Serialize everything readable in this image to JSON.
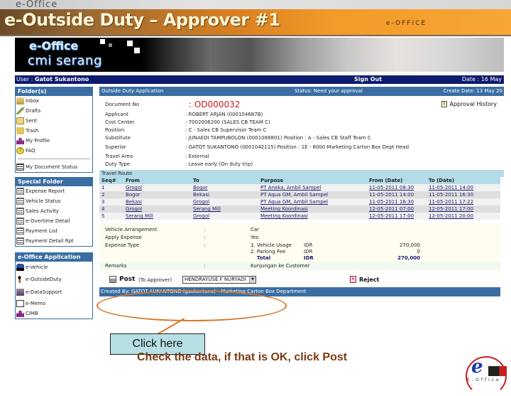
{
  "slide": {
    "top_logo": "e-Office",
    "title": "e-Outside Duty – Approver #1",
    "top_brand_right": "e-OFFICE"
  },
  "hero": {
    "line1": "e-Office",
    "line2": "cmi serang"
  },
  "userbar": {
    "user_label": "User : ",
    "user_name": "Gatot Sukantono",
    "sign_out": "Sign Out",
    "date": "Date : 16 May"
  },
  "sidebar": {
    "folders": {
      "title": "Folder(s)",
      "items": [
        {
          "label": "Inbox",
          "icon": "inbox-folder-icon"
        },
        {
          "label": "Drafts",
          "icon": "drafts-pen-icon"
        },
        {
          "label": "Sent",
          "icon": "sent-mail-icon"
        },
        {
          "label": "Trash",
          "icon": "trash-icon"
        },
        {
          "label": "My Profile",
          "icon": "user-icon"
        },
        {
          "label": "FAQ",
          "icon": "faq-icon"
        }
      ],
      "status_item": {
        "label": "My Document Status",
        "icon": "document-status-icon"
      }
    },
    "special": {
      "title": "Special Folder",
      "items": [
        {
          "label": "Expense Report"
        },
        {
          "label": "Vehicle Status"
        },
        {
          "label": "Sales Activity"
        },
        {
          "label": "e-Overtime Detail"
        },
        {
          "label": "Payment List"
        },
        {
          "label": "Payment Detail Rpt"
        }
      ]
    },
    "apps": {
      "title": "e-Office Application",
      "items": [
        {
          "label": "e-Vehicle",
          "icon": "car-icon"
        },
        {
          "label": "e-OutsideDuty",
          "icon": "walker-icon"
        },
        {
          "label": "e-DataSupport",
          "icon": "data-support-icon"
        },
        {
          "label": "e-Memo",
          "icon": "memo-icon"
        },
        {
          "label": "CIMB",
          "icon": "user-icon"
        }
      ]
    }
  },
  "main": {
    "header": {
      "title": "Outside Duty Application",
      "status": "Status: Need your approval",
      "create_date": "Create Date: 13 May 20"
    },
    "document_no_label": "Document No",
    "document_no": ": OD000032",
    "approval_history": "Approval History",
    "fields": [
      {
        "label": "Applicant",
        "value": ": ROBERT ARJAN (000104687B)"
      },
      {
        "label": "Cost Center",
        "value": ": 7002006200 (SALES CB TEAM C)"
      },
      {
        "label": "Position",
        "value": ": C - Sales CB Supervisor Team C"
      },
      {
        "label": "Substitute",
        "value": ": JUNAEDI TAMPUBOLON (0001088801) Position : A - Sales CB Staff Team C"
      },
      {
        "label": "Superior",
        "value": ": GATOT SUKANTONO (0001042115) Position : 1E - 8000 Marketing Carton Box Dept Head"
      },
      {
        "label": "Travel Area",
        "value": ": External"
      },
      {
        "label": "Duty Type",
        "value": ": Leave early (On duty trip)"
      }
    ],
    "route": {
      "title": "Travel Route",
      "columns": [
        "Seq#",
        "From",
        "To",
        "Purpose",
        "From (Date)",
        "To (Date)"
      ],
      "rows": [
        [
          "1",
          "Grogol",
          "Bogor",
          "PT Aneka, Ambil Sampel",
          "11-05-2011 08:30",
          "11-05-2011 14:00"
        ],
        [
          "2",
          "Bogor",
          "Bekasi",
          "PT Aqua GM, Ambil Sampel",
          "11-05-2011 14:00",
          "11-05-2011 16:30"
        ],
        [
          "3",
          "Bekasi",
          "Grogol",
          "PT Aqua GM, Ambil Sampel",
          "11-05-2011 16:30",
          "11-05-2011 17:22"
        ],
        [
          "4",
          "Grogol",
          "Serang Mill",
          "Meeting Koordinasi",
          "12-05-2011 07:00",
          "12-05-2011 17:00"
        ],
        [
          "5",
          "Serang Mill",
          "Grogol",
          "Meeting Koordinasi",
          "12-05-2011 17:00",
          "12-05-2011 20:00"
        ]
      ]
    },
    "vehicle_arrangement_label": "Vehicle Arrangement",
    "vehicle_arrangement_value": "Car",
    "apply_expense_label": "Apply Expense",
    "apply_expense_value": "Yes",
    "expense_type_label": "Expense Type",
    "separator": ":",
    "expenses": [
      {
        "name": "1. Vehicle Usage",
        "currency": "IDR",
        "amount": "270,000"
      },
      {
        "name": "2. Parking Fee",
        "currency": "IDR",
        "amount": "0"
      }
    ],
    "total": {
      "name": "Total",
      "currency": "IDR",
      "amount": "270,000"
    },
    "remarks_label": "Remarks",
    "remarks_value": "Kunjungan ke Customer",
    "actions": {
      "post": "Post",
      "to_approver": "(To Approver)",
      "approver_selected": "HENDRAYUSE F NURYADI",
      "reject": "Reject"
    },
    "created_by": "Created By: GATOT SUKANTONO (gsukantono) - Marketing Carton Box Department"
  },
  "annotations": {
    "callout": "Click here",
    "hint": "Check the data, if that is OK, click Post",
    "accent_color": "#d8782a"
  },
  "footer_logo": {
    "letter": "e",
    "text": "E-Office"
  }
}
